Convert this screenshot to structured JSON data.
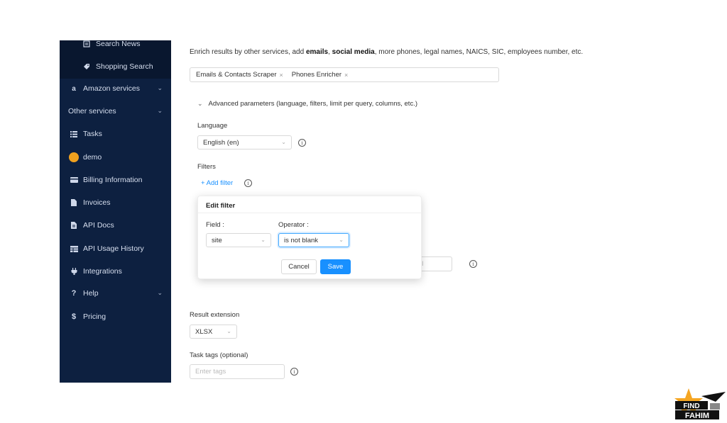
{
  "sidebar": {
    "items": [
      {
        "name": "search-news",
        "label": "Search News",
        "icon": "newspaper-icon"
      },
      {
        "name": "shopping-search",
        "label": "Shopping Search",
        "icon": "tag-icon"
      },
      {
        "name": "amazon-services",
        "label": "Amazon services",
        "icon": "amazon-icon"
      },
      {
        "name": "other-services",
        "label": "Other services"
      },
      {
        "name": "tasks",
        "label": "Tasks",
        "icon": "list-icon"
      },
      {
        "name": "demo",
        "label": "demo",
        "icon": "avatar"
      },
      {
        "name": "billing-information",
        "label": "Billing Information",
        "icon": "credit-card-icon"
      },
      {
        "name": "invoices",
        "label": "Invoices",
        "icon": "file-icon"
      },
      {
        "name": "api-docs",
        "label": "API Docs",
        "icon": "file-text-icon"
      },
      {
        "name": "api-usage-history",
        "label": "API Usage History",
        "icon": "table-icon"
      },
      {
        "name": "integrations",
        "label": "Integrations",
        "icon": "plug-icon"
      },
      {
        "name": "help",
        "label": "Help",
        "icon": "question-icon"
      },
      {
        "name": "pricing",
        "label": "Pricing",
        "icon": "dollar-icon"
      }
    ]
  },
  "main": {
    "intro_prefix": "Enrich results by other services, add ",
    "intro_bold1": "emails",
    "intro_sep": ", ",
    "intro_bold2": "social media",
    "intro_suffix": ", more phones, legal names, NAICS, SIC, employees number, etc.",
    "enrichers": [
      "Emails & Contacts Scraper",
      "Phones Enricher"
    ],
    "advanced_label": "Advanced parameters (language, filters, limit per query, columns, etc.)",
    "language_label": "Language",
    "language_value": "English (en)",
    "filters_label": "Filters",
    "add_filter": "+ Add filter",
    "limit_placeholder": "leave empty to return all",
    "result_extension_label": "Result extension",
    "result_extension_value": "XLSX",
    "task_tags_label": "Task tags (optional)",
    "task_tags_placeholder": "Enter tags"
  },
  "popover": {
    "title": "Edit filter",
    "field_label": "Field :",
    "field_value": "site",
    "operator_label": "Operator :",
    "operator_value": "is not blank",
    "cancel": "Cancel",
    "save": "Save"
  },
  "logo": {
    "line1": "FIND",
    "line2": "FAHIM"
  },
  "colors": {
    "sidebar_bg": "#0d2040",
    "primary": "#1890ff",
    "avatar": "#f0a11f"
  }
}
